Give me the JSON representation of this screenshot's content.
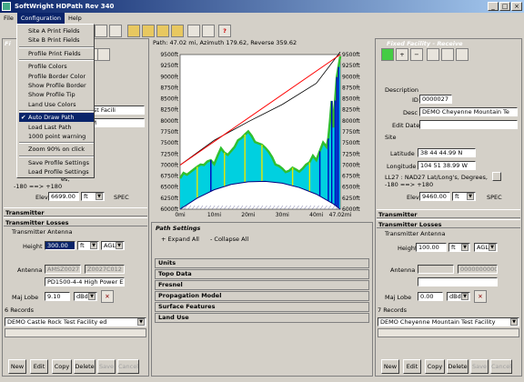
{
  "app": {
    "title": "SoftWright HDPath Rev 340"
  },
  "menubar": {
    "items": [
      "File",
      "Configuration",
      "Help"
    ]
  },
  "config_menu": {
    "items": [
      {
        "label": "Site A Print Fields",
        "checked": false
      },
      {
        "label": "Site B Print Fields",
        "checked": false
      },
      {
        "label": "Profile Print Fields",
        "checked": false
      },
      {
        "label": "Profile Colors",
        "checked": false
      },
      {
        "label": "Profile Border Color",
        "checked": false
      },
      {
        "label": "Show Profile Border",
        "checked": false
      },
      {
        "label": "Show Profile Tip",
        "checked": false
      },
      {
        "label": "Land Use Colors",
        "checked": false
      },
      {
        "label": "Auto Draw Path",
        "checked": true
      },
      {
        "label": "Load Last Path",
        "checked": false
      },
      {
        "label": "1000 point warning",
        "checked": false
      },
      {
        "label": "Zoom 90% on click",
        "checked": false
      },
      {
        "label": "Save Profile Settings",
        "checked": false
      },
      {
        "label": "Load Profile Settings",
        "checked": false
      }
    ]
  },
  "path_info": "Path: 47.02 mi, Azimuth 179.62, Reverse 359.62",
  "left": {
    "panel_title": "Fi",
    "desc_value_frag": "Test Facili",
    "am_frag": "AM",
    "latlong_frag": "es,",
    "range": "-180 ==> +180",
    "elev_label": "Elev",
    "elev_value": "6699.00",
    "elev_unit": "ft",
    "spec": "SPEC",
    "transmitter": "Transmitter",
    "transmitter_losses": "Transmitter Losses",
    "antenna_group": "Transmitter Antenna",
    "height_label": "Height",
    "height_value": "300.00",
    "height_unit": "ft",
    "height_ref": "AGL",
    "antenna_label": "Antenna",
    "antenna_model": "AMSZ0027",
    "antenna_code": "Z0027C012",
    "antenna_desc": "PD1500-4-4 High Power Expo",
    "maj_lobe_label": "Maj Lobe",
    "maj_lobe_value": "9.10",
    "maj_lobe_unit": "dBd",
    "records": "6 Records",
    "selected": "DEMO Castle Rock Test Facility ed",
    "buttons": [
      "New",
      "Edit",
      "Copy",
      "Delete",
      "Save",
      "Cancel"
    ]
  },
  "right": {
    "panel_title": "Fixed Facility - Receive",
    "desc_group": "Description",
    "id_label": "ID",
    "id_value": "0000027",
    "desc_label": "Desc",
    "desc_value": "DEMO Cheyenne Mountain Te",
    "edit_date_label": "Edit Date",
    "site_group": "Site",
    "lat_label": "Latitude",
    "lat_value": "38 44 44.99 N",
    "long_label": "Longitude",
    "long_value": "104 51 38.99 W",
    "datum": "LL27 : NAD27 Lat/Long's, Degrees,",
    "range": "-180 ==> +180",
    "elev_label": "Elev",
    "elev_value": "9460.00",
    "elev_unit": "ft",
    "spec": "SPEC",
    "transmitter": "Transmitter",
    "transmitter_losses": "Transmitter Losses",
    "antenna_group": "Transmitter Antenna",
    "height_label": "Height",
    "height_value": "100.00",
    "height_unit": "ft",
    "height_ref": "AGL",
    "antenna_label": "Antenna",
    "antenna_code": "0000000000",
    "maj_lobe_label": "Maj Lobe",
    "maj_lobe_value": "0.00",
    "maj_lobe_unit": "dBd",
    "records": "7 Records",
    "selected": "DEMO Cheyenne Mountain Test Facility",
    "buttons": [
      "New",
      "Edit",
      "Copy",
      "Delete",
      "Save",
      "Cancel"
    ]
  },
  "path_settings": {
    "title": "Path Settings",
    "expand": "+ Expand All",
    "collapse": "- Collapse All",
    "sections": [
      "Units",
      "Topo Data",
      "Fresnel",
      "Propagation Model",
      "Surface Features",
      "Land Use"
    ]
  },
  "chart_data": {
    "type": "area",
    "xlabel": "",
    "ylabel": "",
    "x_ticks": [
      "0mi",
      "10mi",
      "20mi",
      "30mi",
      "40mi",
      "47.02mi"
    ],
    "y_ticks": [
      "9500ft",
      "9250ft",
      "9000ft",
      "8750ft",
      "8500ft",
      "8250ft",
      "8000ft",
      "7750ft",
      "7500ft",
      "7250ft",
      "7000ft",
      "6750ft",
      "6500ft",
      "6250ft",
      "6000ft"
    ],
    "xlim": [
      0,
      47.02
    ],
    "ylim": [
      6000,
      9500
    ],
    "terrain_x": [
      0,
      1,
      2,
      3,
      4,
      5,
      6,
      7,
      8,
      9,
      10,
      11,
      12,
      13,
      14,
      15,
      16,
      17,
      18,
      19,
      20,
      21,
      22,
      23,
      24,
      25,
      26,
      27,
      28,
      29,
      30,
      31,
      32,
      33,
      34,
      35,
      36,
      37,
      38,
      39,
      40,
      41,
      42,
      43,
      43.5,
      44,
      44.5,
      45,
      45.5,
      46,
      46.5,
      47.02
    ],
    "terrain_y": [
      6699,
      6820,
      6780,
      6840,
      6900,
      6960,
      7010,
      7000,
      7080,
      7110,
      7020,
      7210,
      7380,
      7280,
      7230,
      7320,
      7410,
      7560,
      7610,
      7690,
      7760,
      7660,
      7520,
      7490,
      7460,
      7390,
      7300,
      7180,
      7010,
      6980,
      6920,
      6840,
      6870,
      6940,
      6900,
      6850,
      6920,
      7010,
      7060,
      7210,
      7110,
      7310,
      7510,
      7410,
      7600,
      7990,
      8450,
      7850,
      8460,
      8990,
      9220,
      9460
    ],
    "earth_x": [
      0,
      5,
      10,
      15,
      20,
      25,
      30,
      35,
      40,
      45,
      47.02
    ],
    "earth_y": [
      6000,
      6250,
      6440,
      6560,
      6620,
      6630,
      6590,
      6490,
      6340,
      6120,
      6000
    ],
    "los_x": [
      0,
      47.02
    ],
    "los_y": [
      6999,
      9560
    ],
    "fresnel_x": [
      0,
      10,
      20,
      30,
      40,
      47.02
    ],
    "fresnel_y": [
      6999,
      7560,
      7980,
      8370,
      8850,
      9560
    ],
    "colors": {
      "terrain": "#00d0e0",
      "earth": "#000080",
      "los": "#ff0000",
      "curve": "#000000",
      "vegetation": "#30c030",
      "water": "#0000c0",
      "bright": "#e8e800"
    }
  }
}
